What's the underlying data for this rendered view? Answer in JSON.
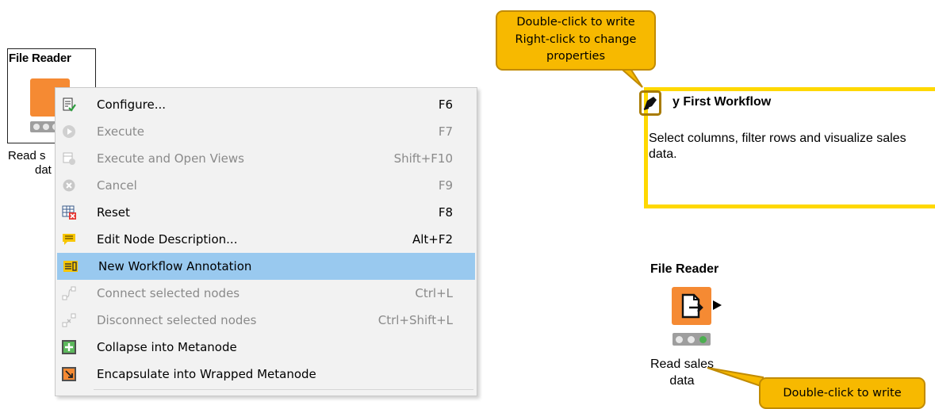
{
  "left_node": {
    "title": "File Reader",
    "label_visible": "Read s",
    "label_line2": "dat"
  },
  "context_menu": {
    "items": [
      {
        "label": "Configure...",
        "shortcut": "F6",
        "enabled": true,
        "icon": "configure-icon"
      },
      {
        "label": "Execute",
        "shortcut": "F7",
        "enabled": false,
        "icon": "execute-icon"
      },
      {
        "label": "Execute and Open Views",
        "shortcut": "Shift+F10",
        "enabled": false,
        "icon": "execute-open-views-icon"
      },
      {
        "label": "Cancel",
        "shortcut": "F9",
        "enabled": false,
        "icon": "cancel-icon"
      },
      {
        "label": "Reset",
        "shortcut": "F8",
        "enabled": true,
        "icon": "reset-icon"
      },
      {
        "label": "Edit Node Description...",
        "shortcut": "Alt+F2",
        "enabled": true,
        "icon": "edit-description-icon"
      },
      {
        "label": "New Workflow Annotation",
        "shortcut": "",
        "enabled": true,
        "highlighted": true,
        "icon": "annotation-icon"
      },
      {
        "label": "Connect selected nodes",
        "shortcut": "Ctrl+L",
        "enabled": false,
        "icon": "connect-nodes-icon"
      },
      {
        "label": "Disconnect selected nodes",
        "shortcut": "Ctrl+Shift+L",
        "enabled": false,
        "icon": "disconnect-nodes-icon"
      },
      {
        "label": "Collapse into Metanode",
        "shortcut": "",
        "enabled": true,
        "icon": "collapse-metanode-icon"
      },
      {
        "label": "Encapsulate into Wrapped Metanode",
        "shortcut": "",
        "enabled": true,
        "icon": "wrapped-metanode-icon"
      }
    ]
  },
  "callout_top": {
    "line1": "Double-click to write",
    "line2": "Right-click to change",
    "line3": "properties"
  },
  "annotation": {
    "title": "My First Workflow",
    "title_visible": "y First Workflow",
    "text": "Select columns, filter rows and visualize sales data."
  },
  "right_node": {
    "title": "File Reader",
    "label": "Read sales data"
  },
  "callout_bottom": {
    "text": "Double-click to write"
  },
  "colors": {
    "node_orange": "#f58a33",
    "annotation_border": "#ffd800",
    "callout_fill": "#f7b900",
    "menu_highlight": "#99c9ef",
    "status_green": "#4caf50"
  }
}
